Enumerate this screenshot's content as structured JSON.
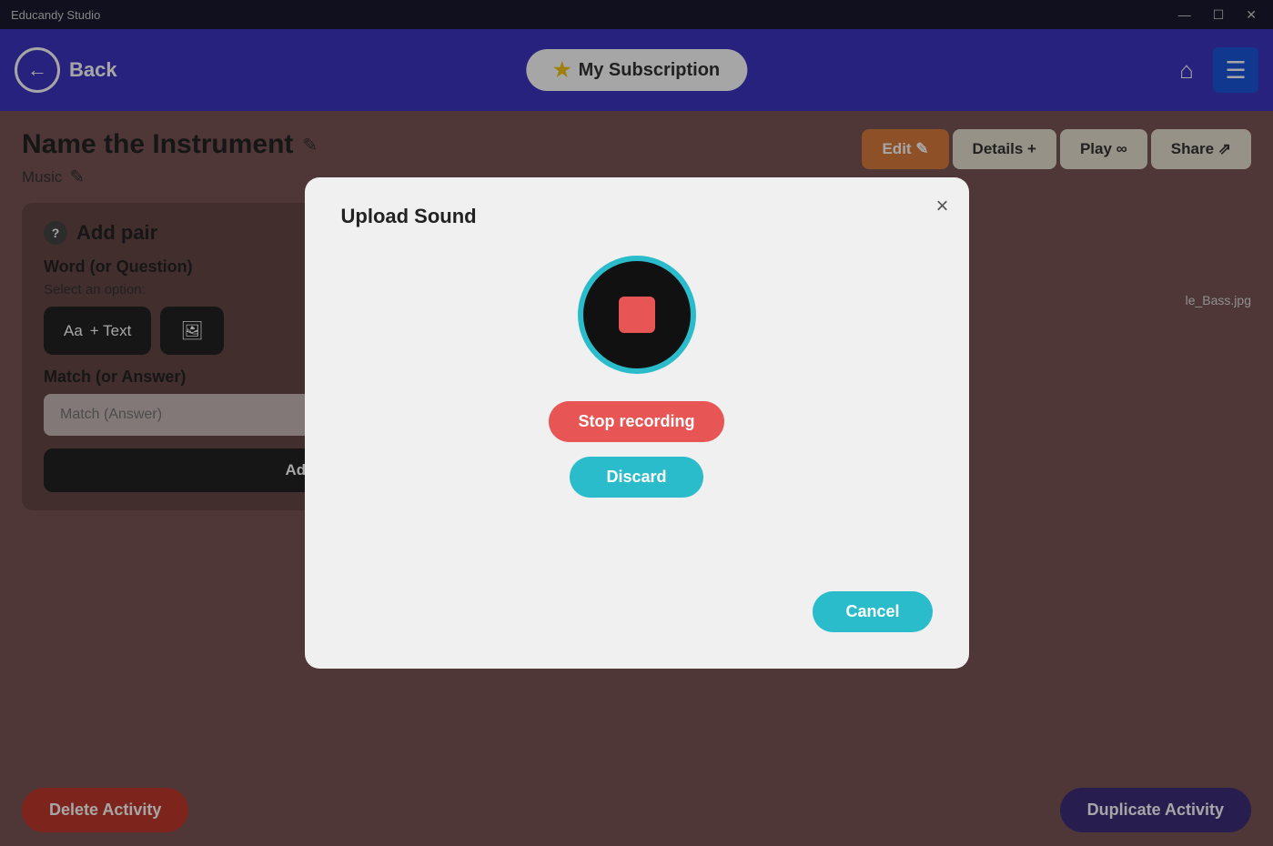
{
  "app": {
    "title": "Educandy Studio",
    "window_controls": {
      "minimize": "—",
      "maximize": "☐",
      "close": "✕"
    }
  },
  "nav": {
    "back_label": "Back",
    "subscription_label": "My Subscription",
    "star_icon": "★",
    "home_icon": "⌂",
    "menu_icon": "☰"
  },
  "page": {
    "title": "Name the Instrument",
    "edit_icon": "✎",
    "subtitle": "Music",
    "subtitle_edit_icon": "✎"
  },
  "action_tabs": [
    {
      "label": "Edit",
      "icon": "✎",
      "type": "edit"
    },
    {
      "label": "Details",
      "icon": "+",
      "type": "details"
    },
    {
      "label": "Play",
      "icon": "∞",
      "type": "play"
    },
    {
      "label": "Share",
      "icon": "⇗",
      "type": "share"
    }
  ],
  "add_pair_section": {
    "title": "Add pair",
    "help_icon": "?",
    "word_section": {
      "label": "Word (or Question)",
      "select_label": "Select an option:",
      "text_btn_label": "+ Text",
      "text_btn_prefix": "Aa",
      "image_btn_icon": "🖼"
    },
    "match_section": {
      "label": "Match (or Answer)",
      "placeholder": "Match (Answer)"
    },
    "add_pair_btn": "Add pair"
  },
  "file_ref": "le_Bass.jpg",
  "bottom": {
    "delete_label": "Delete Activity",
    "duplicate_label": "Duplicate Activity"
  },
  "modal": {
    "title": "Upload Sound",
    "close_icon": "×",
    "record_icon_label": "stop-square",
    "stop_recording_label": "Stop recording",
    "discard_label": "Discard",
    "cancel_label": "Cancel"
  },
  "colors": {
    "nav_bg": "#3d35c0",
    "accent_teal": "#2bbccc",
    "accent_red": "#e85555",
    "accent_orange": "#d97b3c",
    "dark_purple": "#3d2d7a",
    "delete_red": "#c0392b"
  }
}
